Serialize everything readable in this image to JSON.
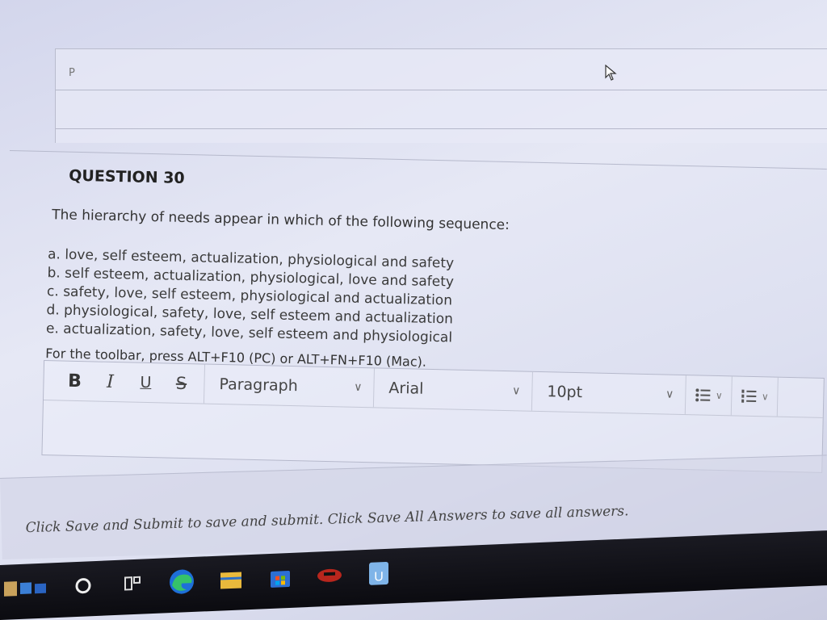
{
  "prev_editor": {
    "paragraph_tag": "P"
  },
  "question": {
    "title": "QUESTION 30",
    "text": "The hierarchy of needs appear in which of the following sequence:",
    "options": [
      "a. love, self esteem, actualization, physiological and safety",
      "b. self esteem, actualization, physiological, love and safety",
      "c. safety, love, self esteem, physiological and actualization",
      "d. physiological, safety, love, self esteem and actualization",
      "e. actualization, safety, love, self esteem and physiological"
    ],
    "toolbar_hint": "For the toolbar, press ALT+F10 (PC) or ALT+FN+F10 (Mac)."
  },
  "toolbar": {
    "bold": "B",
    "italic": "I",
    "underline": "U",
    "strikethrough": "S",
    "paragraph_select": "Paragraph",
    "font_select": "Arial",
    "size_select": "10pt",
    "bullet_list_icon": "bullet-list-icon",
    "numbered_list_icon": "numbered-list-icon"
  },
  "footer": {
    "note": "Click Save and Submit to save and submit. Click Save All Answers to save all answers."
  },
  "taskbar": {
    "icons": [
      "search-icon",
      "task-view-icon",
      "edge-browser-icon",
      "file-explorer-icon",
      "store-icon",
      "game-icon",
      "app-icon"
    ]
  },
  "colors": {
    "accent_blue": "#1e6fd9",
    "page_bg": "#e6e8f5",
    "taskbar": "#0b0b10"
  }
}
